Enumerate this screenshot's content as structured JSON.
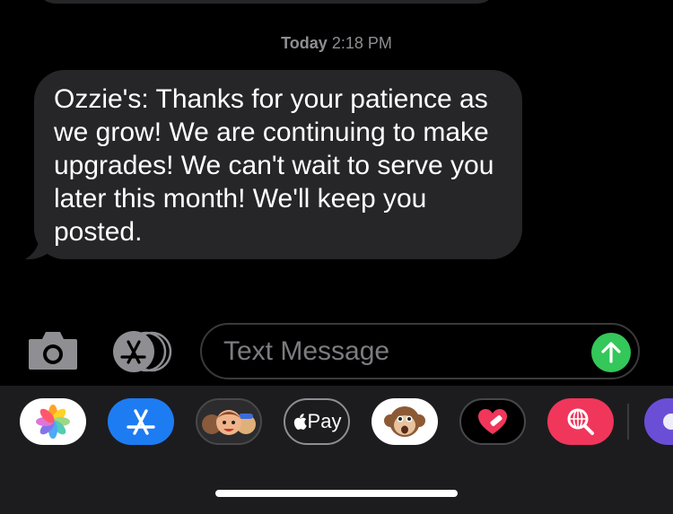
{
  "conversation": {
    "timestamp_day": "Today",
    "timestamp_time": "2:18 PM",
    "message": {
      "text": "Ozzie's: Thanks for your patience as we grow! We are continuing to make upgrades! We can't wait to serve you later this month! We'll keep you posted."
    }
  },
  "composer": {
    "placeholder": "Text Message",
    "value": "",
    "camera_icon": "camera-icon",
    "apps_icon": "app-store-icon",
    "send_icon": "arrow-up-icon"
  },
  "app_drawer": {
    "apps": [
      {
        "name": "photos",
        "icon": "photos-icon"
      },
      {
        "name": "app-store",
        "icon": "app-store-icon"
      },
      {
        "name": "memoji",
        "icon": "memoji-icon"
      },
      {
        "name": "apple-pay",
        "icon": "apple-icon",
        "label": "Pay"
      },
      {
        "name": "animoji",
        "icon": "monkey-icon"
      },
      {
        "name": "digital-touch",
        "icon": "heart-icon"
      },
      {
        "name": "web-images",
        "icon": "globe-search-icon"
      },
      {
        "name": "more",
        "icon": "app-icon"
      }
    ]
  },
  "colors": {
    "background": "#000000",
    "bubble": "#262628",
    "send": "#34c759",
    "app_store": "#1e7cf2",
    "web_images": "#f0365b"
  }
}
